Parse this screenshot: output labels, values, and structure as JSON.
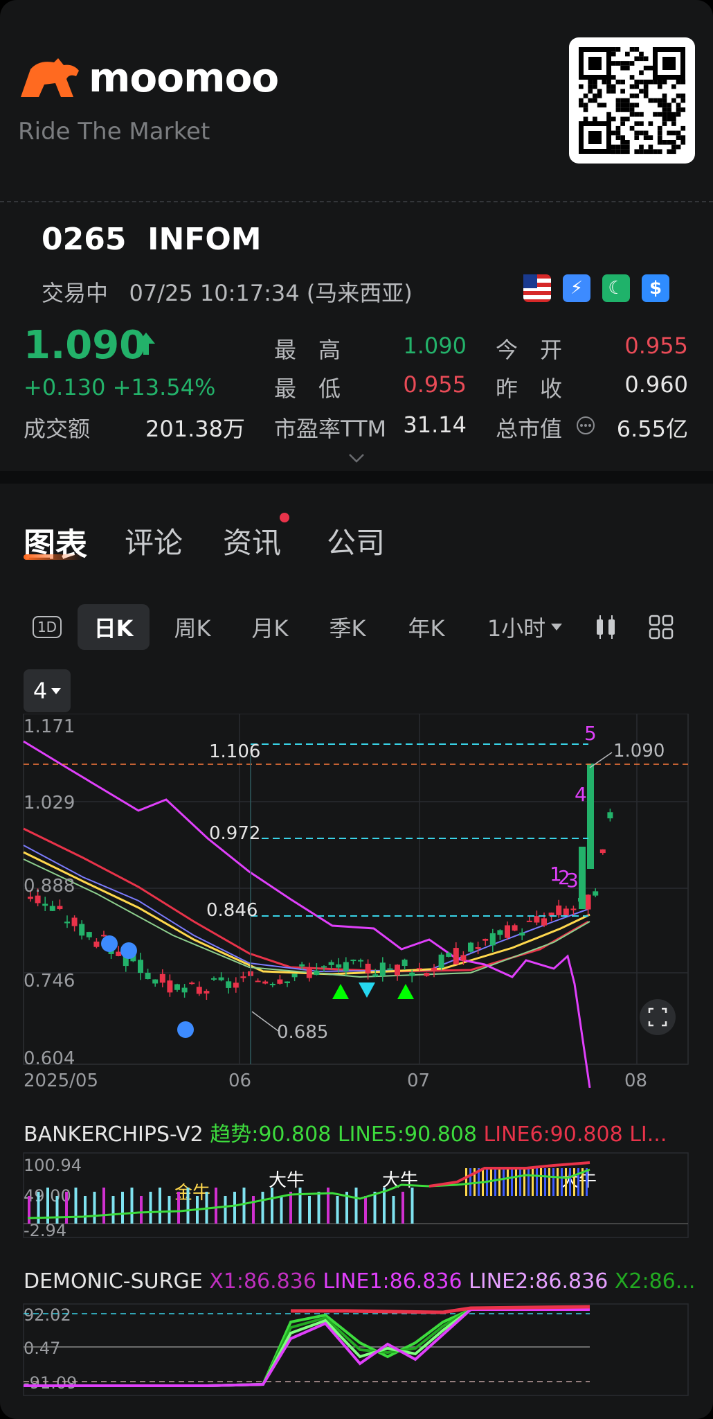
{
  "brand": {
    "name": "moomoo",
    "tagline": "Ride The Market"
  },
  "quote": {
    "code": "0265",
    "name": "INFOM",
    "status": "交易中",
    "datetime": "07/25 10:17:34 (马来西亚)",
    "flags": [
      "malaysia-flag",
      "level2-icon",
      "night-icon",
      "dollar-icon"
    ],
    "price": "1.090",
    "change": "+0.130",
    "change_pct": "+13.54%",
    "stats": [
      {
        "label": "最　高",
        "value": "1.090",
        "color": "green"
      },
      {
        "label": "今　开",
        "value": "0.955",
        "color": "red"
      },
      {
        "label": "最　低",
        "value": "0.955",
        "color": "red"
      },
      {
        "label": "昨　收",
        "value": "0.960",
        "color": "neutral"
      },
      {
        "label": "成交额",
        "value": "201.38万",
        "color": "neutral"
      },
      {
        "label": "市盈率TTM",
        "value": "31.14",
        "color": "neutral"
      },
      {
        "label": "总市值",
        "value": "6.55亿",
        "color": "neutral"
      }
    ]
  },
  "tabs": [
    "图表",
    "评论",
    "资讯",
    "公司"
  ],
  "periods": [
    "1D",
    "日K",
    "周K",
    "月K",
    "季K",
    "年K",
    "1小时"
  ],
  "indicator_count": "4",
  "chart_data": {
    "type": "candlestick",
    "y_ticks": [
      "1.171",
      "1.029",
      "0.888",
      "0.746",
      "0.604"
    ],
    "x_ticks": [
      "2025/05",
      "06",
      "07",
      "08"
    ],
    "levels": [
      "1.106",
      "0.972",
      "0.846"
    ],
    "last_price": "1.090",
    "low_label": "0.685",
    "count_labels": [
      "1",
      "2",
      "3",
      "4",
      "5"
    ]
  },
  "indicators": {
    "bankerchips": {
      "name": "BANKERCHIPS-V2",
      "trend": "趋势:90.808",
      "line5": "LINE5:90.808",
      "line6": "LINE6:90.808 LI...",
      "y_ticks": [
        "100.94",
        "49.00",
        "-2.94"
      ],
      "tags": [
        "金牛",
        "大牛",
        "大牛",
        "大牛"
      ]
    },
    "demonic": {
      "name": "DEMONIC-SURGE",
      "x1": "X1:86.836",
      "line1": "LINE1:86.836",
      "line2": "LINE2:86.836",
      "x2": "X2:86...",
      "y_ticks": [
        "92.02",
        "0.47",
        "-91.09"
      ]
    }
  }
}
